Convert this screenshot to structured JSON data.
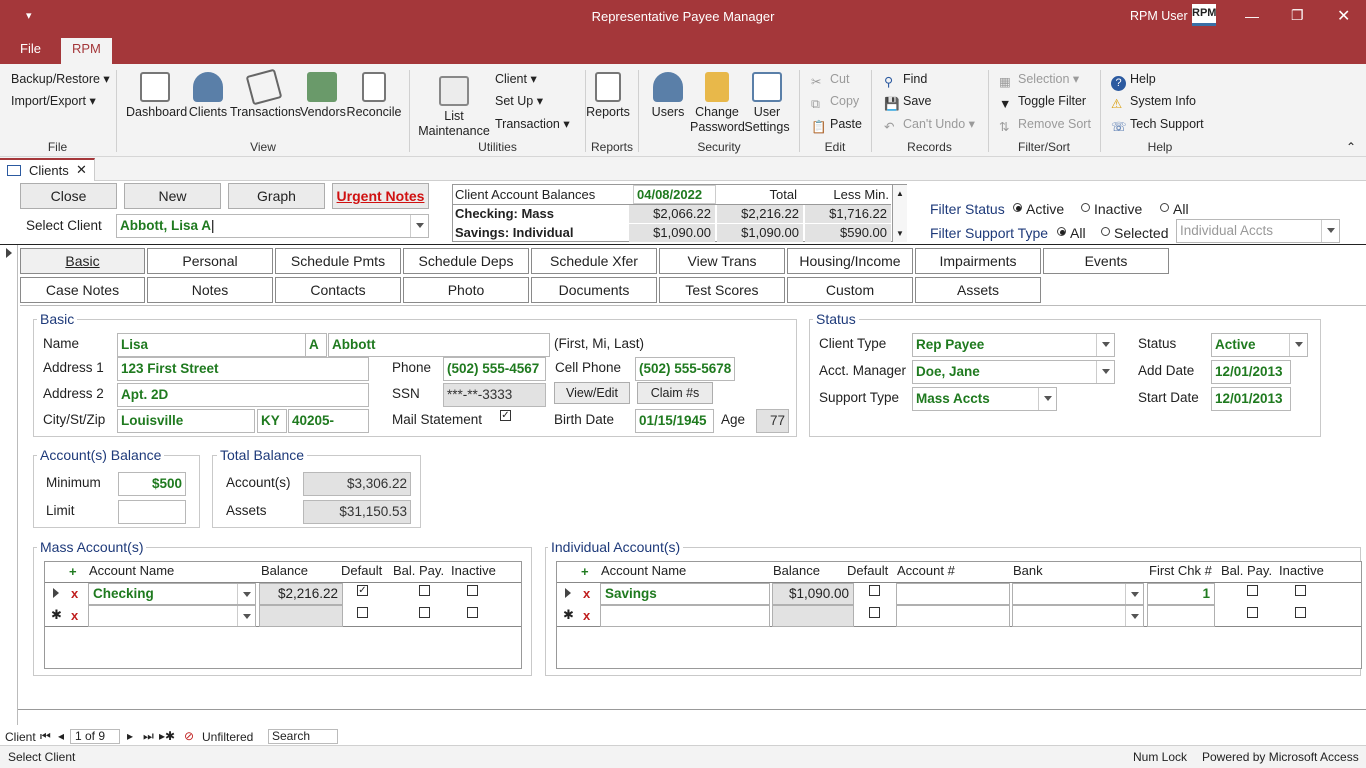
{
  "window": {
    "title": "Representative Payee Manager",
    "user": "RPM User",
    "logo": "RPM"
  },
  "menu": {
    "file": "File",
    "rpm": "RPM"
  },
  "ribbon": {
    "backup": "Backup/Restore",
    "import": "Import/Export",
    "group_file": "File",
    "dashboard": "Dashboard",
    "clients": "Clients",
    "transactions": "Transactions",
    "vendors": "Vendors",
    "reconcile": "Reconcile",
    "group_view": "View",
    "list_maint1": "List",
    "list_maint2": "Maintenance",
    "client": "Client",
    "setup": "Set Up",
    "transaction": "Transaction",
    "group_utilities": "Utilities",
    "reports": "Reports",
    "group_reports": "Reports",
    "users": "Users",
    "change_pw1": "Change",
    "change_pw2": "Password",
    "user_settings1": "User",
    "user_settings2": "Settings",
    "group_security": "Security",
    "cut": "Cut",
    "copy": "Copy",
    "paste": "Paste",
    "group_edit": "Edit",
    "find": "Find",
    "save": "Save",
    "cant_undo": "Can't Undo",
    "group_records": "Records",
    "selection": "Selection",
    "toggle_filter": "Toggle Filter",
    "remove_sort": "Remove Sort",
    "group_filter": "Filter/Sort",
    "help": "Help",
    "system_info": "System Info",
    "tech_support": "Tech Support",
    "group_help": "Help"
  },
  "doc_tab": "Clients",
  "top": {
    "close": "Close",
    "new": "New",
    "graph": "Graph",
    "urgent": "Urgent Notes",
    "select_client_label": "Select Client",
    "select_client_value": "Abbott, Lisa A"
  },
  "balances": {
    "title": "Client Account Balances",
    "date": "04/08/2022",
    "total": "Total",
    "less_min": "Less Min.",
    "rows": [
      {
        "name": "Checking: Mass",
        "a": "$2,066.22",
        "b": "$2,216.22",
        "c": "$1,716.22"
      },
      {
        "name": "Savings: Individual",
        "a": "$1,090.00",
        "b": "$1,090.00",
        "c": "$590.00"
      }
    ]
  },
  "filter": {
    "status_label": "Filter Status",
    "active": "Active",
    "inactive": "Inactive",
    "all": "All",
    "support_label": "Filter Support Type",
    "all2": "All",
    "selected": "Selected",
    "support_value": "Individual Accts"
  },
  "tabs": {
    "row1": [
      "Basic",
      "Personal",
      "Schedule Pmts",
      "Schedule Deps",
      "Schedule Xfer",
      "View Trans",
      "Housing/Income",
      "Impairments",
      "Events"
    ],
    "row2": [
      "Case Notes",
      "Notes",
      "Contacts",
      "Photo",
      "Documents",
      "Test Scores",
      "Custom",
      "Assets"
    ]
  },
  "basic": {
    "legend": "Basic",
    "name_label": "Name",
    "first": "Lisa",
    "mi": "A",
    "last": "Abbott",
    "name_hint": "(First, Mi, Last)",
    "addr1_label": "Address 1",
    "addr1": "123 First Street",
    "addr2_label": "Address 2",
    "addr2": "Apt. 2D",
    "csz_label": "City/St/Zip",
    "city": "Louisville",
    "state": "KY",
    "zip": "40205-",
    "phone_label": "Phone",
    "phone": "(502) 555-4567",
    "cell_label": "Cell Phone",
    "cell": "(502) 555-5678",
    "ssn_label": "SSN",
    "ssn": "***-**-3333",
    "view_edit": "View/Edit",
    "claim": "Claim #s",
    "mail_label": "Mail Statement",
    "birth_label": "Birth Date",
    "birth": "01/15/1945",
    "age_label": "Age",
    "age": "77"
  },
  "status": {
    "legend": "Status",
    "client_type_label": "Client Type",
    "client_type": "Rep Payee",
    "manager_label": "Acct. Manager",
    "manager": "Doe, Jane",
    "support_label": "Support Type",
    "support": "Mass Accts",
    "status_label": "Status",
    "status": "Active",
    "add_label": "Add Date",
    "add": "12/01/2013",
    "start_label": "Start Date",
    "start": "12/01/2013"
  },
  "acct_balance": {
    "legend": "Account(s) Balance",
    "min_label": "Minimum",
    "min": "$500",
    "limit_label": "Limit",
    "limit": ""
  },
  "total_balance": {
    "legend": "Total Balance",
    "accounts_label": "Account(s)",
    "accounts": "$3,306.22",
    "assets_label": "Assets",
    "assets": "$31,150.53"
  },
  "mass": {
    "legend": "Mass Account(s)",
    "h_name": "Account Name",
    "h_balance": "Balance",
    "h_default": "Default",
    "h_balpay": "Bal. Pay.",
    "h_inactive": "Inactive",
    "row_name": "Checking",
    "row_balance": "$2,216.22"
  },
  "indiv": {
    "legend": "Individual Account(s)",
    "h_name": "Account Name",
    "h_balance": "Balance",
    "h_default": "Default",
    "h_acct": "Account #",
    "h_bank": "Bank",
    "h_chk": "First Chk #",
    "h_balpay": "Bal. Pay.",
    "h_inactive": "Inactive",
    "row_name": "Savings",
    "row_balance": "$1,090.00",
    "row_chk": "1"
  },
  "nav": {
    "label": "Client",
    "pos": "1 of 9",
    "filter": "Unfiltered",
    "search": "Search"
  },
  "statusbar": {
    "left": "Select Client",
    "numlock": "Num Lock",
    "powered": "Powered by Microsoft Access"
  },
  "colors": {
    "accent": "#a4373a",
    "value_green": "#1f7a1f",
    "legend_blue": "#1e3a7a",
    "urgent_red": "#d01010"
  }
}
